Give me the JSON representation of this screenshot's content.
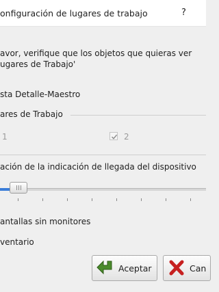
{
  "window": {
    "title": "onfiguración de lugares de trabajo",
    "help_button": "?"
  },
  "message": {
    "line1": "avor, verifique que los objetos que quieras ver",
    "line2": "ugares de Trabajo'"
  },
  "option_detail_master": "sta Detalle-Maestro",
  "workplaces_group": {
    "title": "ares de Trabajo",
    "items": [
      {
        "label": "1",
        "checked": false
      },
      {
        "label": "2",
        "checked": true
      }
    ]
  },
  "arrival_indication": {
    "label": "ación de la indicación de llegada del dispositivo",
    "slider_value_fraction": 0.05
  },
  "option_screens_without_monitors": "antallas sin monitores",
  "option_inventory": "ventario",
  "buttons": {
    "accept": "Aceptar",
    "cancel": "Can"
  },
  "colors": {
    "accent": "#3b7dd8",
    "accept_icon": "#4a8a2c",
    "cancel_icon": "#c62020"
  }
}
